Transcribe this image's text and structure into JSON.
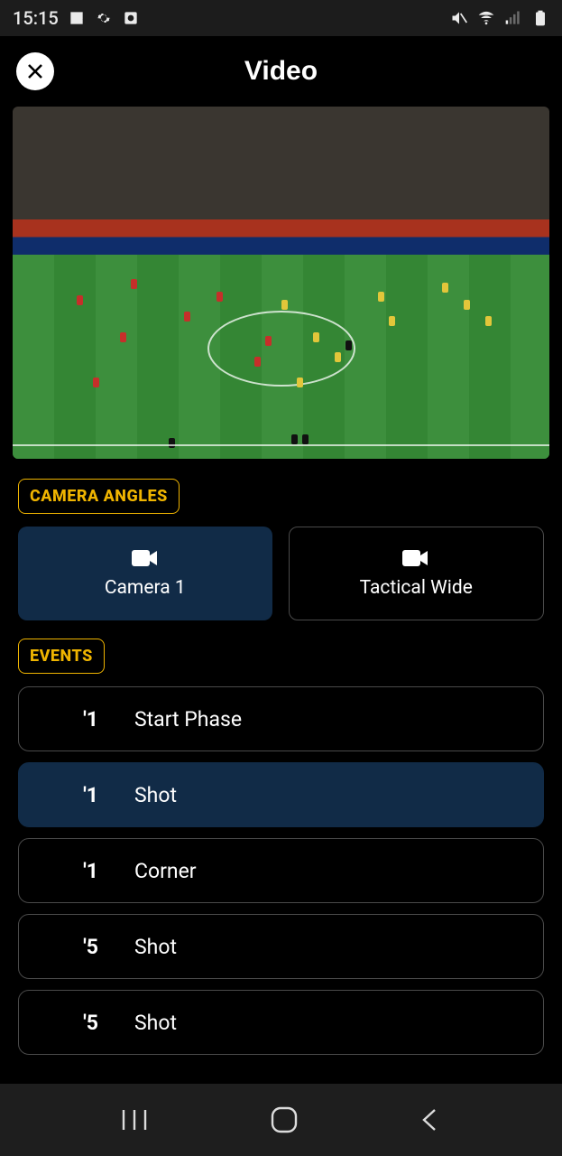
{
  "statusbar": {
    "time": "15:15"
  },
  "header": {
    "title": "Video"
  },
  "sections": {
    "camera": "CAMERA ANGLES",
    "events": "EVENTS"
  },
  "cameras": [
    {
      "label": "Camera 1",
      "active": true
    },
    {
      "label": "Tactical Wide",
      "active": false
    }
  ],
  "events": [
    {
      "minute": "'1",
      "label": "Start Phase",
      "active": false
    },
    {
      "minute": "'1",
      "label": "Shot",
      "active": true
    },
    {
      "minute": "'1",
      "label": "Corner",
      "active": false
    },
    {
      "minute": "'5",
      "label": "Shot",
      "active": false
    },
    {
      "minute": "'5",
      "label": "Shot",
      "active": false
    }
  ]
}
